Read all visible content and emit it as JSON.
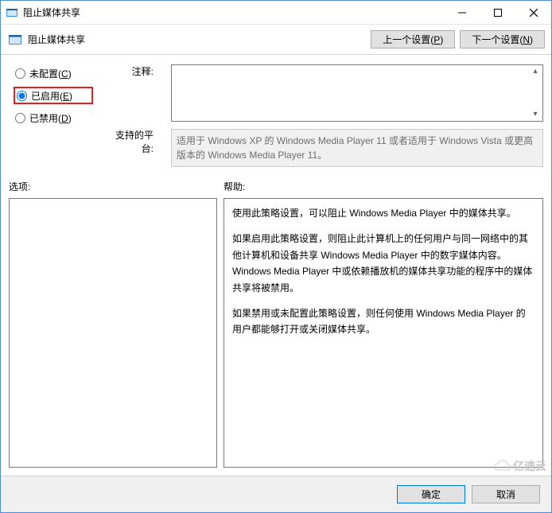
{
  "window": {
    "title": "阻止媒体共享"
  },
  "subheader": {
    "title": "阻止媒体共享",
    "prev_setting": "上一个设置",
    "prev_key": "P",
    "next_setting": "下一个设置",
    "next_key": "N"
  },
  "radios": {
    "not_configured": "未配置",
    "not_configured_key": "C",
    "enabled": "已启用",
    "enabled_key": "E",
    "disabled": "已禁用",
    "disabled_key": "D",
    "selected": "enabled"
  },
  "labels": {
    "comment": "注释:",
    "platform": "支持的平台:",
    "options": "选项:",
    "help": "帮助:"
  },
  "platform_text": "适用于 Windows XP 的 Windows Media Player 11 或者适用于 Windows Vista 或更高版本的 Windows Media Player 11。",
  "help_paragraphs": [
    "使用此策略设置，可以阻止 Windows Media Player 中的媒体共享。",
    "如果启用此策略设置，则阻止此计算机上的任何用户与同一网络中的其他计算机和设备共享 Windows Media Player 中的数字媒体内容。Windows Media Player 中或依赖播放机的媒体共享功能的程序中的媒体共享将被禁用。",
    "如果禁用或未配置此策略设置，则任何使用 Windows Media Player 的用户都能够打开或关闭媒体共享。"
  ],
  "footer": {
    "ok": "确定",
    "cancel": "取消"
  },
  "watermark": "亿速云"
}
